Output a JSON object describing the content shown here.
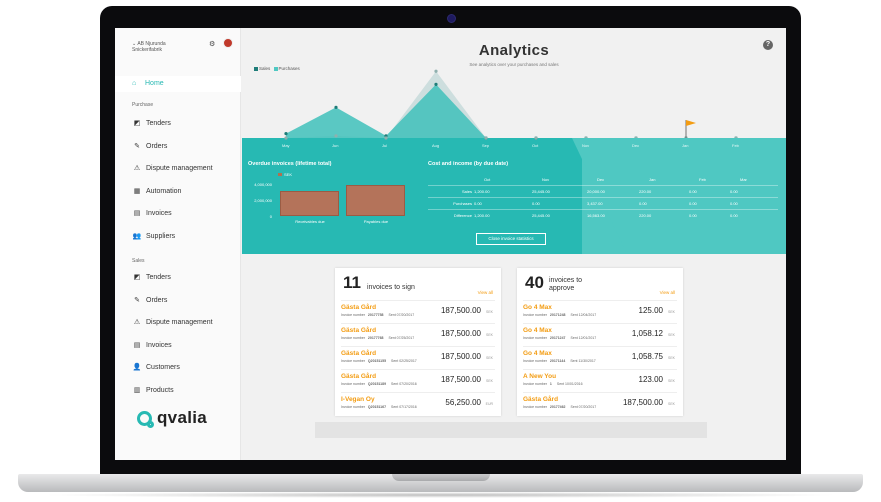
{
  "sidebar": {
    "company": "AB Njurunda Snickerifabrik",
    "home": "Home",
    "purchase_label": "Purchase",
    "purchase_items": [
      {
        "label": "Tenders",
        "icon": "tenders-icon",
        "glyph": "◩"
      },
      {
        "label": "Orders",
        "icon": "pen-icon",
        "glyph": "✎"
      },
      {
        "label": "Dispute management",
        "icon": "warning-icon",
        "glyph": "⚠"
      },
      {
        "label": "Automation",
        "icon": "calendar-icon",
        "glyph": "▦"
      },
      {
        "label": "Invoices",
        "icon": "invoice-icon",
        "glyph": "▤"
      },
      {
        "label": "Suppliers",
        "icon": "people-icon",
        "glyph": "👥"
      }
    ],
    "sales_label": "Sales",
    "sales_items": [
      {
        "label": "Tenders",
        "icon": "tenders-icon",
        "glyph": "◩"
      },
      {
        "label": "Orders",
        "icon": "pen-icon",
        "glyph": "✎"
      },
      {
        "label": "Dispute management",
        "icon": "warning-icon",
        "glyph": "⚠"
      },
      {
        "label": "Invoices",
        "icon": "invoice-icon",
        "glyph": "▤"
      },
      {
        "label": "Customers",
        "icon": "person-icon",
        "glyph": "👤"
      },
      {
        "label": "Products",
        "icon": "barcode-icon",
        "glyph": "▥"
      }
    ],
    "logo_text": "qvalia"
  },
  "header": {
    "title": "Analytics",
    "subtitle": "See analytics over your purchases and sales",
    "help": "?"
  },
  "chart_data": {
    "type": "area",
    "legend": [
      "Sales",
      "Purchases"
    ],
    "categories": [
      "May",
      "Jun",
      "Jul",
      "Aug",
      "Sep",
      "Oct",
      "Nov",
      "Dec",
      "Jan",
      "Feb"
    ],
    "series": [
      {
        "name": "Sales",
        "values": [
          200,
          1400,
          100,
          2450,
          0,
          0,
          0,
          0,
          0,
          0
        ]
      },
      {
        "name": "Purchases",
        "values": [
          0,
          100,
          0,
          3050,
          0,
          0,
          0,
          0,
          0,
          0
        ]
      }
    ]
  },
  "overdue": {
    "title": "Overdue invoices (lifetime total)",
    "legend": "SEK",
    "yticks": [
      "4,000,000",
      "2,000,000",
      "0"
    ],
    "bars": [
      {
        "label": "Receivables due",
        "value": 2900000
      },
      {
        "label": "Payables due",
        "value": 3700000
      }
    ]
  },
  "cost_income": {
    "title": "Cost and income (by due date)",
    "columns": [
      "Oct",
      "Nov",
      "Dec",
      "Jan",
      "Feb",
      "Mar"
    ],
    "rows": [
      {
        "label": "Sales",
        "values": [
          "1,200.00",
          "25,445.00",
          "20,000.00",
          "220.00",
          "0.00",
          "0.00"
        ]
      },
      {
        "label": "Purchases",
        "values": [
          "0.00",
          "0.00",
          "3,437.00",
          "0.00",
          "0.00",
          "0.00"
        ]
      },
      {
        "label": "Difference",
        "values": [
          "1,200.00",
          "25,445.00",
          "16,563.00",
          "220.00",
          "0.00",
          "0.00"
        ]
      }
    ],
    "close_button": "Close invoice statistics"
  },
  "sign_card": {
    "count": "11",
    "title": "invoices to sign",
    "view_all": "View all",
    "items": [
      {
        "name": "Gästa Gård",
        "number": "20177758",
        "sent": "Sent 07/20/2017",
        "amount": "187,500.00",
        "cur": "SEK"
      },
      {
        "name": "Gästa Gård",
        "number": "20177768",
        "sent": "Sent 07/25/2017",
        "amount": "187,500.00",
        "cur": "SEK"
      },
      {
        "name": "Gästa Gård",
        "number": "Q20151155",
        "sent": "Sent 02/25/2017",
        "amount": "187,500.00",
        "cur": "SEK"
      },
      {
        "name": "Gästa Gård",
        "number": "Q20151189",
        "sent": "Sent 07/20/2016",
        "amount": "187,500.00",
        "cur": "SEK"
      },
      {
        "name": "I-Vegan Oy",
        "number": "Q20151167",
        "sent": "Sent 07/17/2016",
        "amount": "56,250.00",
        "cur": "EUR"
      }
    ]
  },
  "approve_card": {
    "count": "40",
    "title_line1": "invoices to",
    "title_line2": "approve",
    "view_all": "View all",
    "items": [
      {
        "name": "Go 4 Max",
        "number": "20171248",
        "sent": "Sent 12/04/2017",
        "amount": "125.00",
        "cur": "SEK"
      },
      {
        "name": "Go 4 Max",
        "number": "20171247",
        "sent": "Sent 12/01/2017",
        "amount": "1,058.12",
        "cur": "SEK"
      },
      {
        "name": "Go 4 Max",
        "number": "20171144",
        "sent": "Sent 11/30/2017",
        "amount": "1,058.75",
        "cur": "SEK"
      },
      {
        "name": "A New You",
        "number": "1",
        "sent": "Sent 10/01/2016",
        "amount": "123.00",
        "cur": "SEK"
      },
      {
        "name": "Gästa Gård",
        "number": "20177462",
        "sent": "Sent 07/20/2017",
        "amount": "187,500.00",
        "cur": "SEK"
      }
    ]
  },
  "invoice_number_label": "Invoice number",
  "colors": {
    "teal": "#27b9b3",
    "orange": "#f39c12",
    "bar": "#b4735a"
  }
}
